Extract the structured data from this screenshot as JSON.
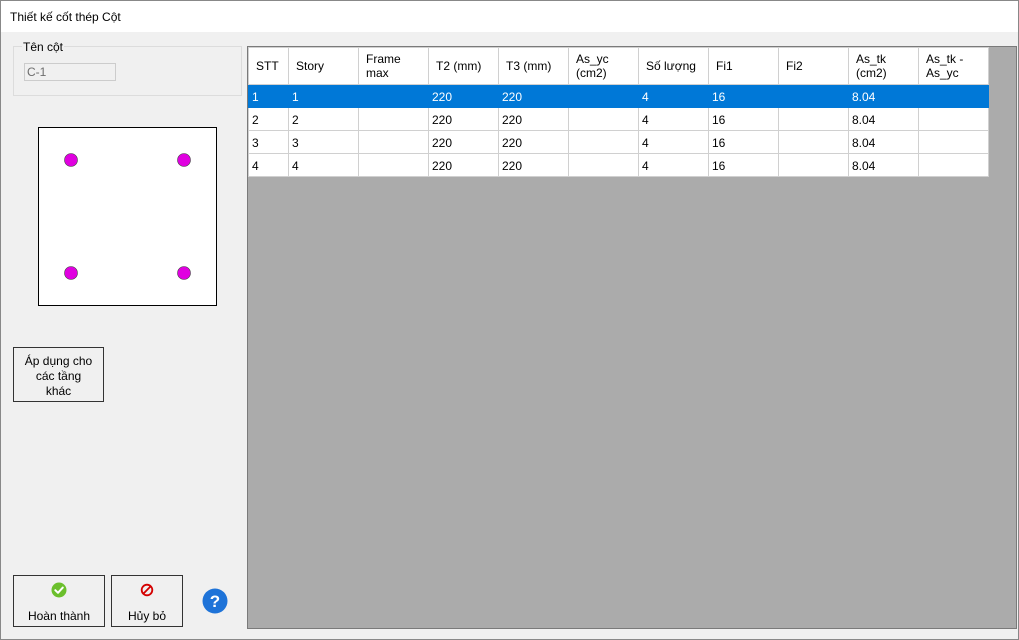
{
  "window": {
    "title": "Thiết kế cốt thép Cột"
  },
  "column_name": {
    "label": "Tên cột",
    "value": "C-1"
  },
  "section_preview": {
    "bar_color": "#e000e0",
    "bars": [
      {
        "col": "left",
        "row": "top"
      },
      {
        "col": "right",
        "row": "top"
      },
      {
        "col": "left",
        "row": "bottom"
      },
      {
        "col": "right",
        "row": "bottom"
      }
    ]
  },
  "buttons": {
    "apply_line1": "Áp dụng cho",
    "apply_line2": "các tầng",
    "apply_line3": "khác",
    "done": "Hoàn thành",
    "cancel": "Hủy bỏ",
    "help_icon": "question-icon"
  },
  "table": {
    "headers": [
      {
        "l1": "STT",
        "l2": ""
      },
      {
        "l1": "Story",
        "l2": ""
      },
      {
        "l1": "Frame",
        "l2": "max"
      },
      {
        "l1": "T2 (mm)",
        "l2": ""
      },
      {
        "l1": "T3 (mm)",
        "l2": ""
      },
      {
        "l1": "As_yc",
        "l2": "(cm2)"
      },
      {
        "l1": "Số lượng",
        "l2": ""
      },
      {
        "l1": "Fi1",
        "l2": ""
      },
      {
        "l1": "Fi2",
        "l2": ""
      },
      {
        "l1": "As_tk",
        "l2": "(cm2)"
      },
      {
        "l1": "As_tk -",
        "l2": "As_yc"
      }
    ],
    "rows": [
      {
        "stt": "1",
        "story": "1",
        "frame": "",
        "t2": "220",
        "t3": "220",
        "as_yc": "",
        "qty": "4",
        "fi1": "16",
        "fi2": "",
        "as_tk": "8.04",
        "diff": ""
      },
      {
        "stt": "2",
        "story": "2",
        "frame": "",
        "t2": "220",
        "t3": "220",
        "as_yc": "",
        "qty": "4",
        "fi1": "16",
        "fi2": "",
        "as_tk": "8.04",
        "diff": ""
      },
      {
        "stt": "3",
        "story": "3",
        "frame": "",
        "t2": "220",
        "t3": "220",
        "as_yc": "",
        "qty": "4",
        "fi1": "16",
        "fi2": "",
        "as_tk": "8.04",
        "diff": ""
      },
      {
        "stt": "4",
        "story": "4",
        "frame": "",
        "t2": "220",
        "t3": "220",
        "as_yc": "",
        "qty": "4",
        "fi1": "16",
        "fi2": "",
        "as_tk": "8.04",
        "diff": ""
      }
    ],
    "selected_row": 0,
    "selection_color": "#0078d7"
  },
  "colors": {
    "done_icon": "#6bbf2c",
    "cancel_icon": "#d40000",
    "help_icon": "#1e73d8"
  }
}
